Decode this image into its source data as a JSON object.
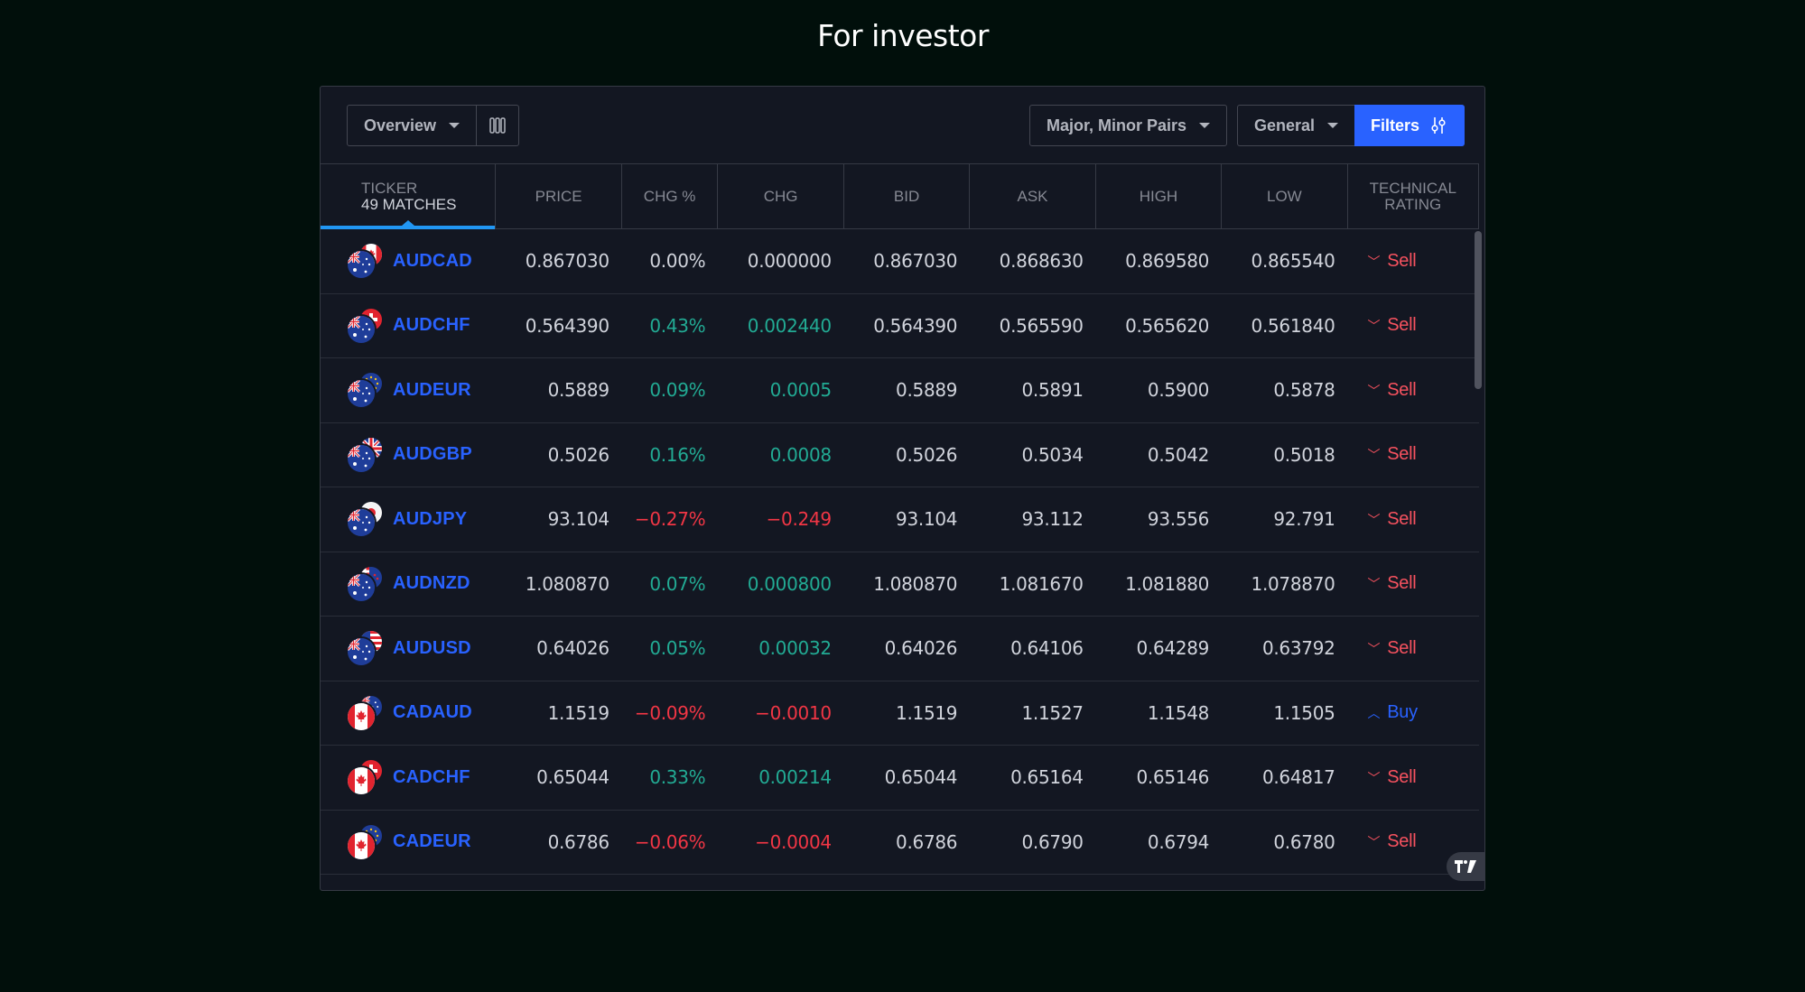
{
  "page": {
    "title": "For investor"
  },
  "toolbar": {
    "view_dropdown": "Overview",
    "columns_icon": "column-layout-icon",
    "market_dropdown": "Major, Minor Pairs",
    "category_dropdown": "General",
    "filters_label": "Filters",
    "filters_icon": "sliders-icon"
  },
  "table": {
    "headers": {
      "ticker": "TICKER",
      "matches": "49 MATCHES",
      "price": "PRICE",
      "chg_pct": "CHG %",
      "chg": "CHG",
      "bid": "BID",
      "ask": "ASK",
      "high": "HIGH",
      "low": "LOW",
      "rating_line1": "TECHNICAL",
      "rating_line2": "RATING"
    },
    "rows": [
      {
        "ticker": "AUDCAD",
        "base": "AUD",
        "quote": "CAD",
        "price": "0.867030",
        "chg_pct": "0.00%",
        "chg": "0.000000",
        "dir": "flat",
        "bid": "0.867030",
        "ask": "0.868630",
        "high": "0.869580",
        "low": "0.865540",
        "rating": "Sell"
      },
      {
        "ticker": "AUDCHF",
        "base": "AUD",
        "quote": "CHF",
        "price": "0.564390",
        "chg_pct": "0.43%",
        "chg": "0.002440",
        "dir": "pos",
        "bid": "0.564390",
        "ask": "0.565590",
        "high": "0.565620",
        "low": "0.561840",
        "rating": "Sell"
      },
      {
        "ticker": "AUDEUR",
        "base": "AUD",
        "quote": "EUR",
        "price": "0.5889",
        "chg_pct": "0.09%",
        "chg": "0.0005",
        "dir": "pos",
        "bid": "0.5889",
        "ask": "0.5891",
        "high": "0.5900",
        "low": "0.5878",
        "rating": "Sell"
      },
      {
        "ticker": "AUDGBP",
        "base": "AUD",
        "quote": "GBP",
        "price": "0.5026",
        "chg_pct": "0.16%",
        "chg": "0.0008",
        "dir": "pos",
        "bid": "0.5026",
        "ask": "0.5034",
        "high": "0.5042",
        "low": "0.5018",
        "rating": "Sell"
      },
      {
        "ticker": "AUDJPY",
        "base": "AUD",
        "quote": "JPY",
        "price": "93.104",
        "chg_pct": "−0.27%",
        "chg": "−0.249",
        "dir": "neg",
        "bid": "93.104",
        "ask": "93.112",
        "high": "93.556",
        "low": "92.791",
        "rating": "Sell"
      },
      {
        "ticker": "AUDNZD",
        "base": "AUD",
        "quote": "NZD",
        "price": "1.080870",
        "chg_pct": "0.07%",
        "chg": "0.000800",
        "dir": "pos",
        "bid": "1.080870",
        "ask": "1.081670",
        "high": "1.081880",
        "low": "1.078870",
        "rating": "Sell"
      },
      {
        "ticker": "AUDUSD",
        "base": "AUD",
        "quote": "USD",
        "price": "0.64026",
        "chg_pct": "0.05%",
        "chg": "0.00032",
        "dir": "pos",
        "bid": "0.64026",
        "ask": "0.64106",
        "high": "0.64289",
        "low": "0.63792",
        "rating": "Sell"
      },
      {
        "ticker": "CADAUD",
        "base": "CAD",
        "quote": "AUD",
        "price": "1.1519",
        "chg_pct": "−0.09%",
        "chg": "−0.0010",
        "dir": "neg",
        "bid": "1.1519",
        "ask": "1.1527",
        "high": "1.1548",
        "low": "1.1505",
        "rating": "Buy"
      },
      {
        "ticker": "CADCHF",
        "base": "CAD",
        "quote": "CHF",
        "price": "0.65044",
        "chg_pct": "0.33%",
        "chg": "0.00214",
        "dir": "pos",
        "bid": "0.65044",
        "ask": "0.65164",
        "high": "0.65146",
        "low": "0.64817",
        "rating": "Sell"
      },
      {
        "ticker": "CADEUR",
        "base": "CAD",
        "quote": "EUR",
        "price": "0.6786",
        "chg_pct": "−0.06%",
        "chg": "−0.0004",
        "dir": "neg",
        "bid": "0.6786",
        "ask": "0.6790",
        "high": "0.6794",
        "low": "0.6780",
        "rating": "Sell"
      }
    ]
  },
  "colors": {
    "accent": "#2962ff",
    "positive": "#22ab94",
    "negative": "#f23645",
    "sell": "#f7525f",
    "background": "#010f0b",
    "panel": "#131722"
  },
  "footer": {
    "logo": "TradingView",
    "logo_text": "TV"
  }
}
